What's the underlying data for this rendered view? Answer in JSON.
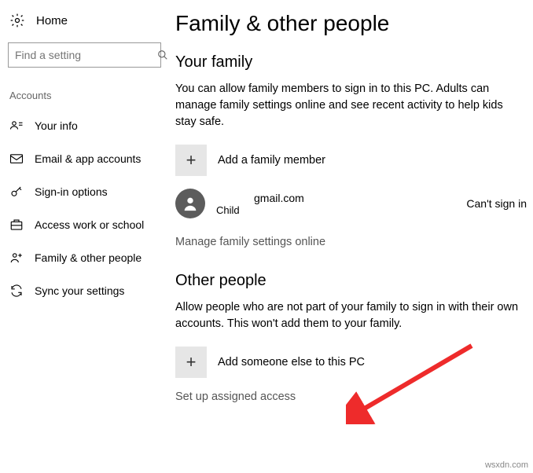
{
  "sidebar": {
    "home_label": "Home",
    "search_placeholder": "Find a setting",
    "section_heading": "Accounts",
    "items": [
      {
        "label": "Your info"
      },
      {
        "label": "Email & app accounts"
      },
      {
        "label": "Sign-in options"
      },
      {
        "label": "Access work or school"
      },
      {
        "label": "Family & other people"
      },
      {
        "label": "Sync your settings"
      }
    ]
  },
  "main": {
    "title": "Family & other people",
    "family": {
      "heading": "Your family",
      "desc": "You can allow family members to sign in to this PC. Adults can manage family settings online and see recent activity to help kids stay safe.",
      "add_label": "Add a family member",
      "member": {
        "email_user": "",
        "email_domain": "gmail.com",
        "role": "Child",
        "status": "Can't sign in"
      },
      "manage_link": "Manage family settings online"
    },
    "other": {
      "heading": "Other people",
      "desc": "Allow people who are not part of your family to sign in with their own accounts. This won't add them to your family.",
      "add_label": "Add someone else to this PC",
      "assigned_link": "Set up assigned access"
    }
  },
  "watermark": "wsxdn.com"
}
